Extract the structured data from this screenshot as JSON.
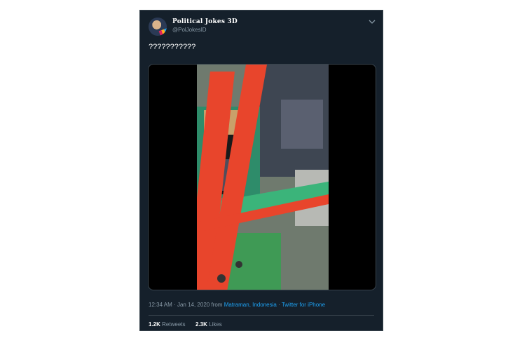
{
  "tweet": {
    "display_name": "Political Jokes 3D",
    "handle": "@PolJokesID",
    "text": "???????????",
    "time": "12:34 AM",
    "date": "Jan 14, 2020",
    "from_label": "from",
    "location": "Matraman, Indonesia",
    "client": "Twitter for iPhone",
    "separator": "·",
    "retweets_count": "1.2K",
    "retweets_label": "Retweets",
    "likes_count": "2.3K",
    "likes_label": "Likes"
  },
  "colors": {
    "background": "#15202b",
    "text": "#ffffff",
    "secondary": "#8899a6",
    "link": "#1da1f2",
    "border": "#38444d"
  },
  "icons": [
    "chevron-down-icon"
  ]
}
